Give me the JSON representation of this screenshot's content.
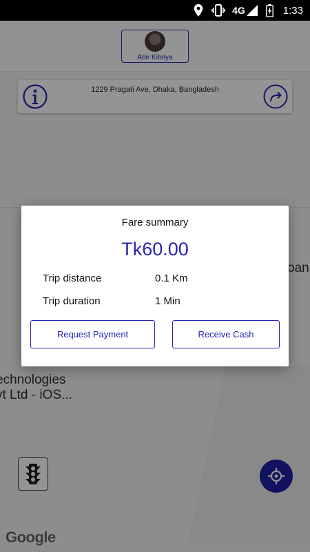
{
  "status_bar": {
    "network": "4G",
    "time": "1:33",
    "icons": [
      "location-icon",
      "vibrate-icon",
      "signal-icon",
      "battery-icon"
    ]
  },
  "header": {
    "profile_name": "Abir Kibriya"
  },
  "address_bar": {
    "address": "1229 Pragati Ave, Dhaka, Bangladesh"
  },
  "map": {
    "poi_line1": "echnologies",
    "poi_line2": "vt Ltd - iOS...",
    "poi_right": "oan",
    "attribution": "Google"
  },
  "dialog": {
    "title": "Fare summary",
    "amount": "Tk60.00",
    "rows": [
      {
        "label": "Trip distance",
        "value": "0.1 Km"
      },
      {
        "label": "Trip duration",
        "value": "1 Min"
      }
    ],
    "request_payment_label": "Request Payment",
    "receive_cash_label": "Receive Cash"
  },
  "colors": {
    "accent": "#2424b4",
    "overlay": "rgba(0,0,0,0.42)"
  }
}
